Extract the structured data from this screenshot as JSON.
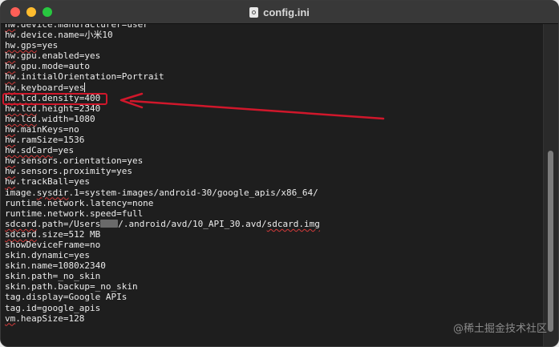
{
  "window": {
    "title": "config.ini"
  },
  "editor": {
    "lines": [
      {
        "pre": "",
        "sq": "hw",
        "post": ".device.manufacturer=user"
      },
      {
        "pre": "hw.device.name=小米10",
        "sq": "",
        "post": ""
      },
      {
        "pre": "",
        "sq": "hw.gps",
        "post": "=yes"
      },
      {
        "pre": "",
        "sq": "hw",
        "post": ".gpu.enabled=yes"
      },
      {
        "pre": "",
        "sq": "hw",
        "post": ".gpu.mode=auto"
      },
      {
        "pre": "",
        "sq": "hw",
        "post": ".initialOrientation=Portrait"
      },
      {
        "pre": "",
        "sq": "hw",
        "post": ".keyboard=yes",
        "cursor": true
      },
      {
        "pre": "",
        "sq": "hw.lcd",
        "post": ".density=400"
      },
      {
        "pre": "",
        "sq": "hw.lcd",
        "post": ".height=2340"
      },
      {
        "pre": "",
        "sq": "hw.lcd",
        "post": ".width=1080"
      },
      {
        "pre": "",
        "sq": "hw",
        "post": ".mainKeys=no"
      },
      {
        "pre": "",
        "sq": "hw",
        "post": ".ramSize=1536"
      },
      {
        "pre": "",
        "sq": "hw.sdCard",
        "post": "=yes"
      },
      {
        "pre": "",
        "sq": "hw",
        "post": ".sensors.orientation=yes"
      },
      {
        "pre": "",
        "sq": "hw",
        "post": ".sensors.proximity=yes"
      },
      {
        "pre": "",
        "sq": "hw",
        "post": ".trackBall=yes"
      },
      {
        "pre": "image.",
        "sq": "sysdir",
        "post": ".1=system-images/android-30/google_apis/x86_64/"
      },
      {
        "pre": "runtime.network.latency=none",
        "sq": "",
        "post": ""
      },
      {
        "pre": "runtime.network.speed=full",
        "sq": "",
        "post": ""
      },
      {
        "pre": "",
        "sq": "sdcard",
        "post": ".path=/Users",
        "redact": true,
        "post2": "/.android/avd/10_API_30.avd/",
        "sq2": "sdcard.img"
      },
      {
        "pre": "",
        "sq": "sdcard",
        "post": ".size=512 MB"
      },
      {
        "pre": "showDeviceFrame=no",
        "sq": "",
        "post": ""
      },
      {
        "pre": "skin.dynamic=yes",
        "sq": "",
        "post": ""
      },
      {
        "pre": "skin.name=1080x2340",
        "sq": "",
        "post": ""
      },
      {
        "pre": "skin.path=_no_skin",
        "sq": "",
        "post": ""
      },
      {
        "pre": "skin.path.backup=_no_skin",
        "sq": "",
        "post": ""
      },
      {
        "pre": "tag.display=Google APIs",
        "sq": "",
        "post": ""
      },
      {
        "pre": "tag.id=google_apis",
        "sq": "",
        "post": ""
      },
      {
        "pre": "",
        "sq": "vm",
        "post": ".heapSize=128"
      }
    ]
  },
  "annotation": {
    "color": "#d0172b"
  },
  "watermark": {
    "text": "@稀土掘金技术社区"
  }
}
